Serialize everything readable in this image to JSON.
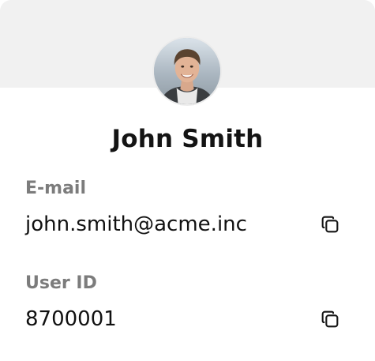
{
  "profile": {
    "name": "John Smith",
    "avatar_icon": "user-photo"
  },
  "fields": {
    "email": {
      "label": "E-mail",
      "value": "john.smith@acme.inc",
      "action_icon": "copy-icon"
    },
    "user_id": {
      "label": "User ID",
      "value": "8700001",
      "action_icon": "copy-icon"
    }
  },
  "colors": {
    "cover": "#f1f1f1",
    "label": "#7c7c7c",
    "text": "#111111"
  }
}
